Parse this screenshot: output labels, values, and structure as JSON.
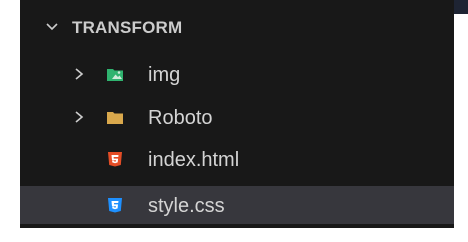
{
  "explorer": {
    "section_title": "TRANSFORM",
    "section_chevron": "chevron-down-icon",
    "items": [
      {
        "label": "img",
        "kind": "folder",
        "icon": "image-folder-icon",
        "expandable": true
      },
      {
        "label": "Roboto",
        "kind": "folder",
        "icon": "folder-icon",
        "expandable": true
      },
      {
        "label": "index.html",
        "kind": "file",
        "icon": "html5-icon",
        "expandable": false
      },
      {
        "label": "style.css",
        "kind": "file",
        "icon": "css3-icon",
        "expandable": false,
        "selected": true
      }
    ]
  },
  "colors": {
    "panel_bg": "#181818",
    "selected_row_bg": "#37373d",
    "text": "#cccccc",
    "folder": "#d9a84c",
    "image_folder": "#2fb36f",
    "html_icon": "#e44d26",
    "css_icon": "#1e90ff"
  }
}
